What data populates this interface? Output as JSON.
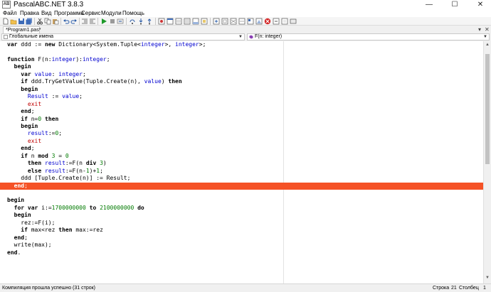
{
  "window": {
    "title": "PascalABC.NET 3.8.3",
    "app_icon_text": "AB",
    "minimize": "—",
    "maximize": "☐",
    "close": "✕"
  },
  "menu": [
    "Файл",
    "Правка",
    "Вид",
    "Программа",
    "Сервис",
    "Модули",
    "Помощь"
  ],
  "toolbar": {
    "icons": [
      "new-file-icon",
      "open-folder-icon",
      "save-icon",
      "save-all-icon",
      "cut-icon",
      "copy-icon",
      "paste-icon",
      "undo-icon",
      "redo-icon",
      "indent-icon",
      "outdent-icon",
      "run-icon",
      "stop-icon",
      "compile-icon",
      "step-over-icon",
      "step-into-icon",
      "step-out-icon",
      "breakpoint-icon",
      "debug-window-icon",
      "watch-icon",
      "locals-icon",
      "output-icon",
      "form-designer-icon",
      "close-program-icon",
      "help-icon",
      "module-icon"
    ]
  },
  "tabs": [
    {
      "label": "*Program1.pas*",
      "close": "✕"
    }
  ],
  "tab_controls": {
    "dropdown": "▾",
    "close": "✕"
  },
  "combos": {
    "scope": "Глобальные имена",
    "member": "F(n: integer)"
  },
  "code": {
    "lines": [
      [
        [
          "var",
          "k"
        ],
        [
          " ddd := ",
          ""
        ],
        [
          "new",
          "k"
        ],
        [
          " Dictionary<System.Tuple<",
          ""
        ],
        [
          "integer",
          "ty"
        ],
        [
          ">, ",
          ""
        ],
        [
          "integer",
          "ty"
        ],
        [
          ">;",
          ""
        ]
      ],
      [],
      [
        [
          "function",
          "k"
        ],
        [
          " F(n:",
          ""
        ],
        [
          "integer",
          "ty"
        ],
        [
          "):",
          ""
        ],
        [
          "integer",
          "ty"
        ],
        [
          ";",
          ""
        ]
      ],
      [
        [
          "  begin",
          "k"
        ]
      ],
      [
        [
          "    ",
          ""
        ],
        [
          "var",
          "k"
        ],
        [
          " ",
          ""
        ],
        [
          "value",
          "sv"
        ],
        [
          ": ",
          ""
        ],
        [
          "integer",
          "ty"
        ],
        [
          ";",
          ""
        ]
      ],
      [
        [
          "    ",
          ""
        ],
        [
          "if",
          "k"
        ],
        [
          " ddd.TryGetValue(Tuple.Create(n), ",
          ""
        ],
        [
          "value",
          "sv"
        ],
        [
          ") ",
          ""
        ],
        [
          "then",
          "k"
        ]
      ],
      [
        [
          "    ",
          ""
        ],
        [
          "begin",
          "k"
        ]
      ],
      [
        [
          "      ",
          ""
        ],
        [
          "Result",
          "sv"
        ],
        [
          " := ",
          ""
        ],
        [
          "value",
          "sv"
        ],
        [
          ";",
          ""
        ]
      ],
      [
        [
          "      ",
          ""
        ],
        [
          "exit",
          "ex"
        ]
      ],
      [
        [
          "    ",
          ""
        ],
        [
          "end",
          "k"
        ],
        [
          ";",
          ""
        ]
      ],
      [
        [
          "    ",
          ""
        ],
        [
          "if",
          "k"
        ],
        [
          " n=",
          ""
        ],
        [
          "0",
          "nm"
        ],
        [
          " ",
          ""
        ],
        [
          "then",
          "k"
        ]
      ],
      [
        [
          "    ",
          ""
        ],
        [
          "begin",
          "k"
        ]
      ],
      [
        [
          "      ",
          ""
        ],
        [
          "result",
          "sv"
        ],
        [
          ":=",
          ""
        ],
        [
          "0",
          "nm"
        ],
        [
          ";",
          ""
        ]
      ],
      [
        [
          "      ",
          ""
        ],
        [
          "exit",
          "ex"
        ]
      ],
      [
        [
          "    ",
          ""
        ],
        [
          "end",
          "k"
        ],
        [
          ";",
          ""
        ]
      ],
      [
        [
          "    ",
          ""
        ],
        [
          "if",
          "k"
        ],
        [
          " n ",
          ""
        ],
        [
          "mod",
          "k"
        ],
        [
          " ",
          ""
        ],
        [
          "3",
          "nm"
        ],
        [
          " = ",
          ""
        ],
        [
          "0",
          "nm"
        ]
      ],
      [
        [
          "      ",
          ""
        ],
        [
          "then",
          "k"
        ],
        [
          " ",
          ""
        ],
        [
          "result",
          "sv"
        ],
        [
          ":=F(n ",
          ""
        ],
        [
          "div",
          "k"
        ],
        [
          " ",
          ""
        ],
        [
          "3",
          "nm"
        ],
        [
          ")",
          ""
        ]
      ],
      [
        [
          "      ",
          ""
        ],
        [
          "else",
          "k"
        ],
        [
          " ",
          ""
        ],
        [
          "result",
          "sv"
        ],
        [
          ":=F(n-",
          ""
        ],
        [
          "1",
          "nm"
        ],
        [
          ")+",
          ""
        ],
        [
          "1",
          "nm"
        ],
        [
          ";",
          ""
        ]
      ],
      [
        [
          "    ddd [Tuple.Create(n)] := Result;",
          ""
        ]
      ],
      [
        [
          "  ",
          ""
        ],
        [
          "end",
          "k"
        ],
        [
          ";",
          ""
        ]
      ],
      [],
      [
        [
          "begin",
          "k"
        ]
      ],
      [
        [
          "  ",
          ""
        ],
        [
          "for",
          "k"
        ],
        [
          " ",
          ""
        ],
        [
          "var",
          "k"
        ],
        [
          " i:=",
          ""
        ],
        [
          "1700000000",
          "nm"
        ],
        [
          " ",
          ""
        ],
        [
          "to",
          "k"
        ],
        [
          " ",
          ""
        ],
        [
          "2100000000",
          "nm"
        ],
        [
          " ",
          ""
        ],
        [
          "do",
          "k"
        ]
      ],
      [
        [
          "  ",
          ""
        ],
        [
          "begin",
          "k"
        ]
      ],
      [
        [
          "    rez:=F(i);",
          ""
        ]
      ],
      [
        [
          "    ",
          ""
        ],
        [
          "if",
          "k"
        ],
        [
          " max<rez ",
          ""
        ],
        [
          "then",
          "k"
        ],
        [
          " max:=rez",
          ""
        ]
      ],
      [
        [
          "  ",
          ""
        ],
        [
          "end",
          "k"
        ],
        [
          ";",
          ""
        ]
      ],
      [
        [
          "  write(max);",
          ""
        ]
      ],
      [
        [
          "end",
          "k"
        ],
        [
          ".",
          ""
        ]
      ]
    ],
    "highlighted_line": 19
  },
  "status": {
    "message": "Компиляция прошла успешно (31 строк)",
    "row_label": "Строка",
    "row_value": "21",
    "col_label": "Столбец",
    "col_value": "1"
  }
}
